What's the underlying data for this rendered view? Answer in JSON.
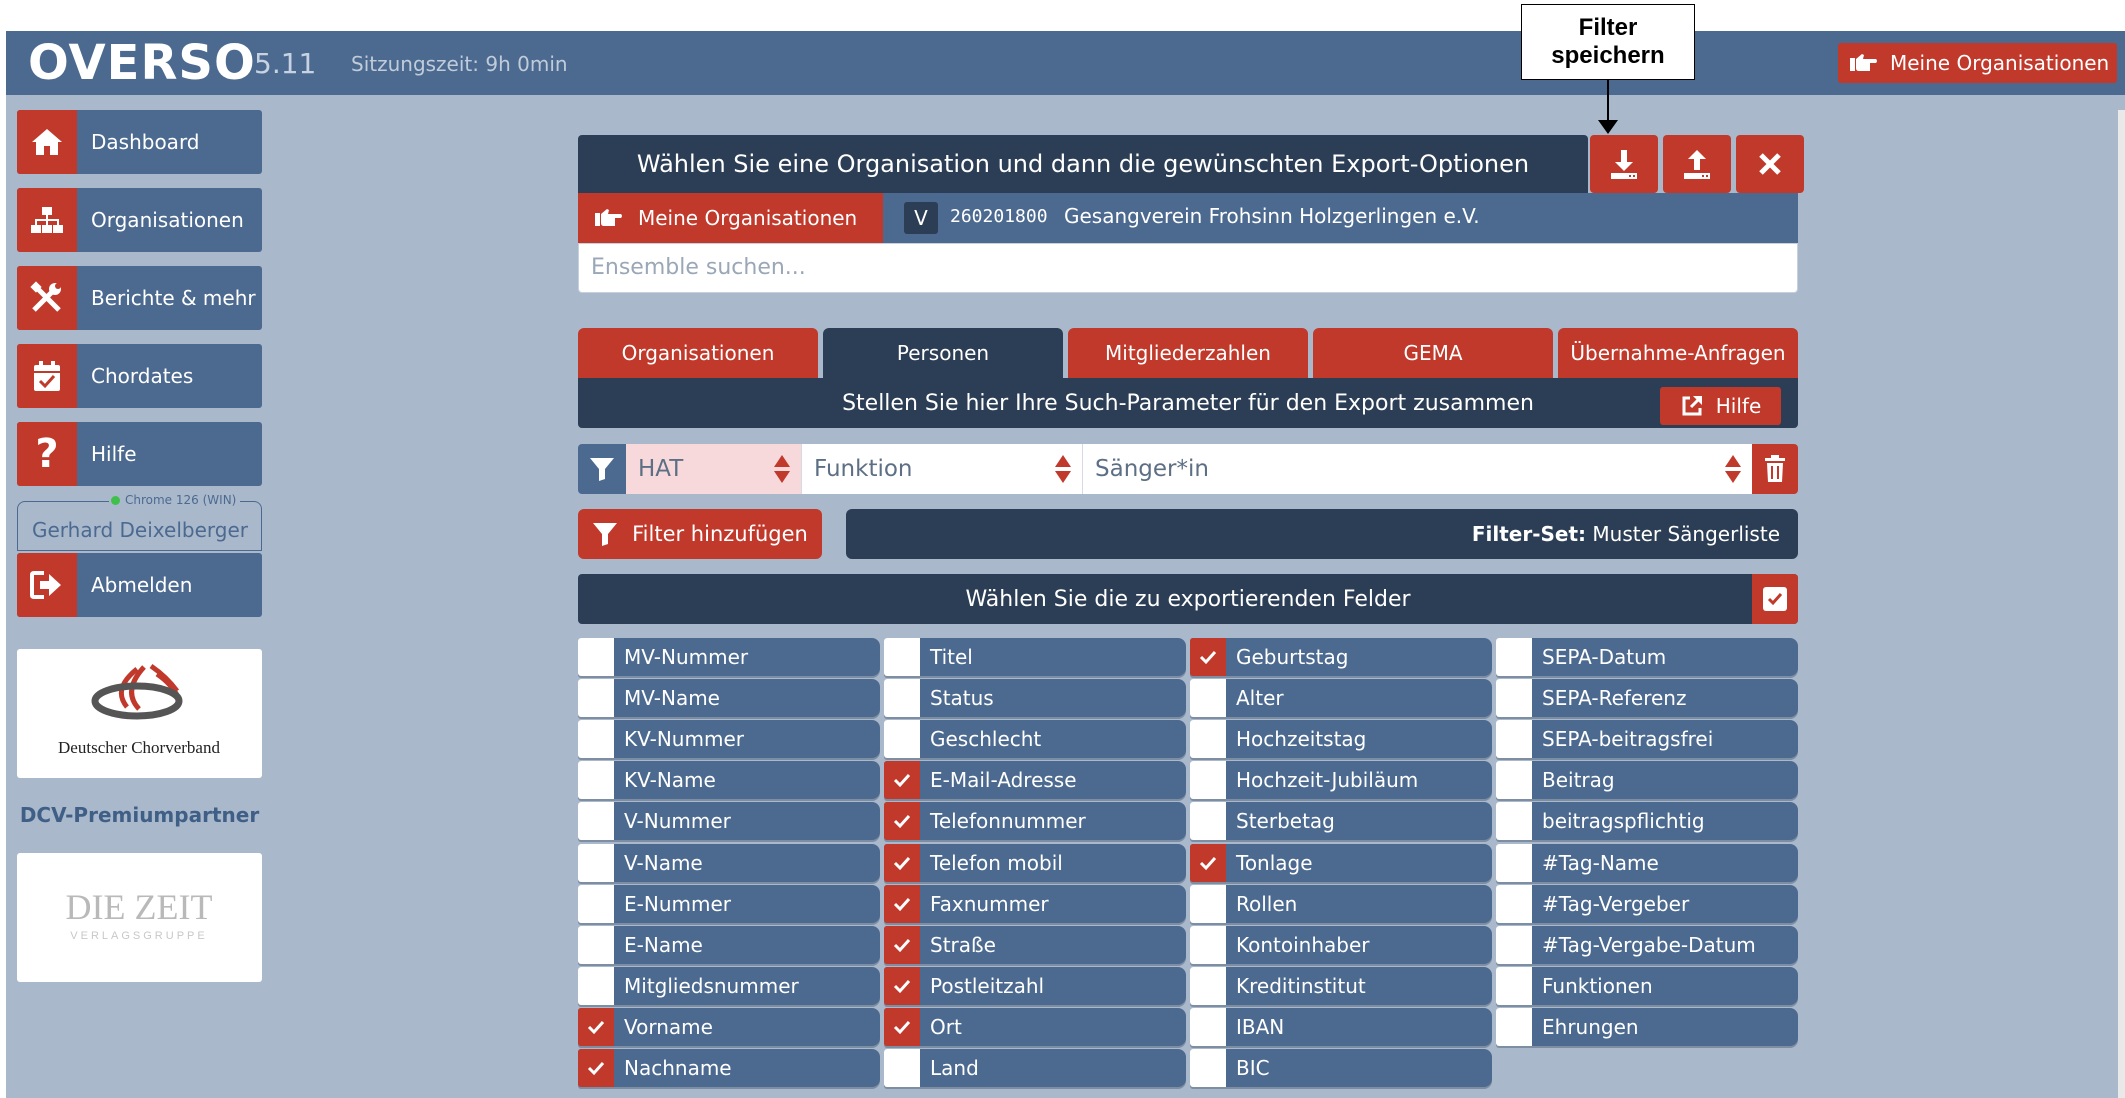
{
  "app": {
    "name": "OVERSO",
    "version": "5.11",
    "session": "Sitzungszeit: 9h 0min"
  },
  "topbar": {
    "my_orgs": "Meine Organisationen"
  },
  "sidebar": {
    "items": [
      {
        "label": "Dashboard",
        "icon": "home-icon"
      },
      {
        "label": "Organisationen",
        "icon": "org-chart-icon"
      },
      {
        "label": "Berichte & mehr",
        "icon": "tools-icon"
      },
      {
        "label": "Chordates",
        "icon": "calendar-check-icon"
      },
      {
        "label": "Hilfe",
        "icon": "question-icon"
      }
    ],
    "browser": "Chrome 126 (WIN)",
    "user": "Gerhard Deixelberger",
    "logout": "Abmelden",
    "dcv_logo_text": "Deutscher Chorverband",
    "partner_label": "DCV-Premiumpartner",
    "zeit_logo_text": "DIE ZEIT",
    "zeit_logo_sub": "VERLAGSGRUPPE"
  },
  "export": {
    "header": "Wählen Sie eine Organisation und dann die gewünschten Export-Optionen",
    "my_orgs": "Meine Organisationen",
    "org_type": "V",
    "org_number": "260201800",
    "org_name": "Gesangverein Frohsinn Holzgerlingen e.V.",
    "search_placeholder": "Ensemble suchen..."
  },
  "tabs": [
    {
      "label": "Organisationen",
      "active": false
    },
    {
      "label": "Personen",
      "active": true
    },
    {
      "label": "Mitgliederzahlen",
      "active": false
    },
    {
      "label": "GEMA",
      "active": false
    },
    {
      "label": "Übernahme-Anfragen",
      "active": false
    }
  ],
  "params": {
    "title": "Stellen Sie hier Ihre Such-Parameter für den Export zusammen",
    "help": "Hilfe"
  },
  "filter": {
    "op": "HAT",
    "field": "Funktion",
    "value": "Sänger*in"
  },
  "add_filter": "Filter hinzufügen",
  "filterset": {
    "label": "Filter-Set:",
    "value": "Muster Sängerliste"
  },
  "fields_title": "Wählen Sie die zu exportierenden Felder",
  "fields": [
    [
      {
        "label": "MV-Nummer",
        "checked": false
      },
      {
        "label": "MV-Name",
        "checked": false
      },
      {
        "label": "KV-Nummer",
        "checked": false
      },
      {
        "label": "KV-Name",
        "checked": false
      },
      {
        "label": "V-Nummer",
        "checked": false
      },
      {
        "label": "V-Name",
        "checked": false
      },
      {
        "label": "E-Nummer",
        "checked": false
      },
      {
        "label": "E-Name",
        "checked": false
      },
      {
        "label": "Mitgliedsnummer",
        "checked": false
      },
      {
        "label": "Vorname",
        "checked": true
      },
      {
        "label": "Nachname",
        "checked": true
      }
    ],
    [
      {
        "label": "Titel",
        "checked": false
      },
      {
        "label": "Status",
        "checked": false
      },
      {
        "label": "Geschlecht",
        "checked": false
      },
      {
        "label": "E-Mail-Adresse",
        "checked": true
      },
      {
        "label": "Telefonnummer",
        "checked": true
      },
      {
        "label": "Telefon mobil",
        "checked": true
      },
      {
        "label": "Faxnummer",
        "checked": true
      },
      {
        "label": "Straße",
        "checked": true
      },
      {
        "label": "Postleitzahl",
        "checked": true
      },
      {
        "label": "Ort",
        "checked": true
      },
      {
        "label": "Land",
        "checked": false
      }
    ],
    [
      {
        "label": "Geburtstag",
        "checked": true
      },
      {
        "label": "Alter",
        "checked": false
      },
      {
        "label": "Hochzeitstag",
        "checked": false
      },
      {
        "label": "Hochzeit-Jubiläum",
        "checked": false
      },
      {
        "label": "Sterbetag",
        "checked": false
      },
      {
        "label": "Tonlage",
        "checked": true
      },
      {
        "label": "Rollen",
        "checked": false
      },
      {
        "label": "Kontoinhaber",
        "checked": false
      },
      {
        "label": "Kreditinstitut",
        "checked": false
      },
      {
        "label": "IBAN",
        "checked": false
      },
      {
        "label": "BIC",
        "checked": false
      }
    ],
    [
      {
        "label": "SEPA-Datum",
        "checked": false
      },
      {
        "label": "SEPA-Referenz",
        "checked": false
      },
      {
        "label": "SEPA-beitragsfrei",
        "checked": false
      },
      {
        "label": "Beitrag",
        "checked": false
      },
      {
        "label": "beitragspflichtig",
        "checked": false
      },
      {
        "label": "#Tag-Name",
        "checked": false
      },
      {
        "label": "#Tag-Vergeber",
        "checked": false
      },
      {
        "label": "#Tag-Vergabe-Datum",
        "checked": false
      },
      {
        "label": "Funktionen",
        "checked": false
      },
      {
        "label": "Ehrungen",
        "checked": false
      }
    ]
  ],
  "callout": "Filter speichern",
  "colors": {
    "red": "#c0392b",
    "navy": "#2c3e55",
    "blue": "#4c6a90",
    "background": "#a9b8cb"
  }
}
